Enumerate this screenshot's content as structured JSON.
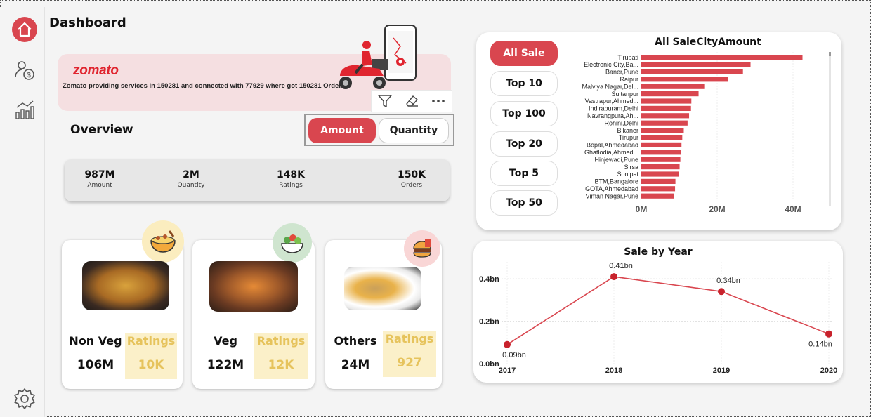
{
  "page": {
    "title": "Dashboard"
  },
  "sidebar": {
    "items": [
      "home-icon",
      "sales-icon",
      "analytics-icon",
      "settings-icon"
    ]
  },
  "banner": {
    "brand": "zomato",
    "tagline": "Zomato providing services in 150281 and connected with 77929 where got 150281 Orders"
  },
  "toolbar": {
    "icons": [
      "filter-icon",
      "eraser-icon",
      "more-icon"
    ]
  },
  "overview": {
    "title": "Overview",
    "toggle": {
      "amount": "Amount",
      "quantity": "Quantity",
      "selected": "Amount"
    },
    "kpis": [
      {
        "value": "987M",
        "label": "Amount"
      },
      {
        "value": "2M",
        "label": "Quantity"
      },
      {
        "value": "148K",
        "label": "Ratings"
      },
      {
        "value": "150K",
        "label": "Orders"
      }
    ]
  },
  "categories": [
    {
      "name": "Non Veg",
      "amount": "106M",
      "ratings_label": "Ratings",
      "ratings": "10K"
    },
    {
      "name": "Veg",
      "amount": "122M",
      "ratings_label": "Ratings",
      "ratings": "12K"
    },
    {
      "name": "Others",
      "amount": "24M",
      "ratings_label": "Ratings",
      "ratings": "927"
    }
  ],
  "filters": {
    "items": [
      "All Sale",
      "Top 10",
      "Top 100",
      "Top 20",
      "Top 5",
      "Top 50"
    ],
    "selected": "All Sale"
  },
  "colors": {
    "accent": "#d9464f",
    "rating": "#e6c35c",
    "rating_bg": "#fbf0c9",
    "banner_bg": "#f5dfe1"
  },
  "chart_data": [
    {
      "type": "bar",
      "orientation": "horizontal",
      "title": "All SaleCityAmount",
      "categories": [
        "Tirupati",
        "Electronic City,Ba...",
        "Baner,Pune",
        "Raipur",
        "Malviya Nagar,Del...",
        "Sultanpur",
        "Vastrapur,Ahmed...",
        "Indirapuram,Delhi",
        "Navrangpura,Ah...",
        "Rohini,Delhi",
        "Bikaner",
        "Tirupur",
        "Bopal,Ahmedabad",
        "Ghatlodia,Ahmed...",
        "Hinjewadi,Pune",
        "Sirsa",
        "Sonipat",
        "BTM,Bangalore",
        "GOTA,Ahmedabad",
        "Viman Nagar,Pune"
      ],
      "values": [
        42.5,
        28.8,
        26.8,
        22.8,
        16.6,
        15.1,
        13.2,
        13.1,
        12.6,
        12.2,
        11.2,
        10.8,
        10.6,
        10.4,
        10.3,
        10.1,
        10.0,
        9.0,
        8.9,
        8.7
      ],
      "unit": "M",
      "xticks": [
        "0M",
        "20M",
        "40M"
      ],
      "xlim": [
        0,
        50
      ],
      "grid": false,
      "legend": "none"
    },
    {
      "type": "line",
      "title": "Sale by Year",
      "x": [
        "2017",
        "2018",
        "2019",
        "2020"
      ],
      "values": [
        0.09,
        0.41,
        0.34,
        0.14
      ],
      "labels": [
        "0.09bn",
        "0.41bn",
        "0.34bn",
        "0.14bn"
      ],
      "yticks": [
        "0.0bn",
        "0.2bn",
        "0.4bn"
      ],
      "ylim": [
        0,
        0.45
      ],
      "grid": true,
      "legend": "none",
      "color": "#d9464f"
    }
  ]
}
